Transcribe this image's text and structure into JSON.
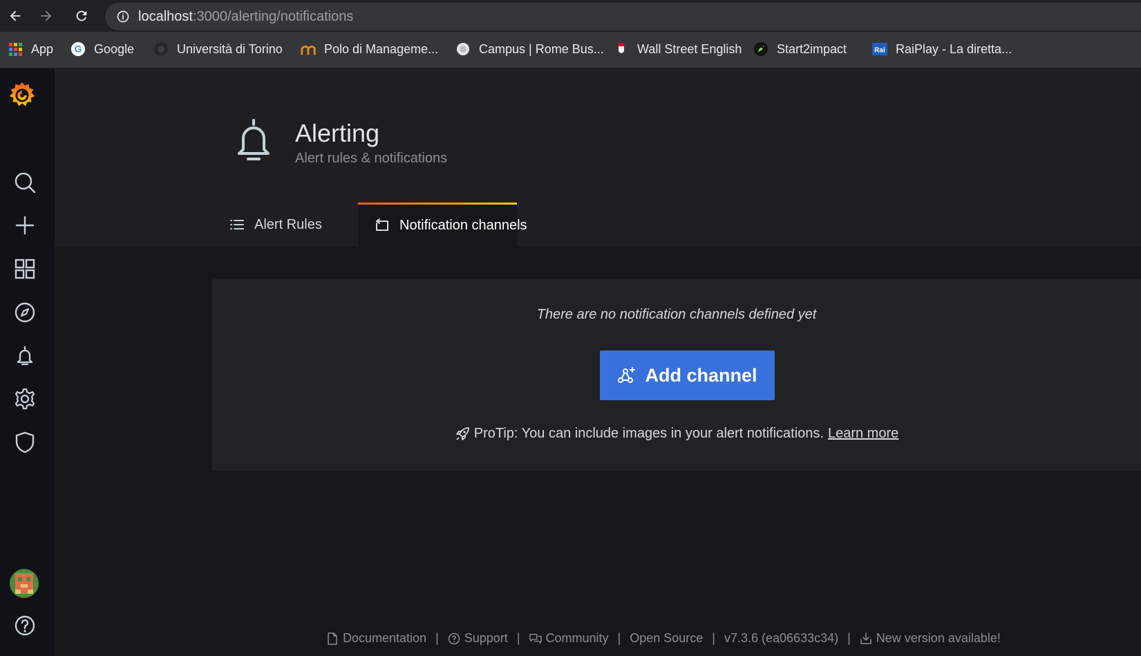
{
  "browser": {
    "url_host": "localhost",
    "url_rest": ":3000/alerting/notifications",
    "bookmarks": [
      {
        "label": "App",
        "icon": "apps-grid-icon"
      },
      {
        "label": "Google",
        "icon": "google-icon"
      },
      {
        "label": "Università di Torino",
        "icon": "unito-icon"
      },
      {
        "label": "Polo di Manageme...",
        "icon": "polo-icon"
      },
      {
        "label": "Campus | Rome Bus...",
        "icon": "campus-icon"
      },
      {
        "label": "Wall Street English",
        "icon": "wse-icon"
      },
      {
        "label": "Start2impact",
        "icon": "rocket-icon"
      },
      {
        "label": "RaiPlay - La diretta...",
        "icon": "rai-icon"
      }
    ]
  },
  "sidebar": {
    "items": [
      {
        "name": "search",
        "icon": "search-icon"
      },
      {
        "name": "create",
        "icon": "plus-icon"
      },
      {
        "name": "dashboards",
        "icon": "apps-icon"
      },
      {
        "name": "explore",
        "icon": "compass-icon"
      },
      {
        "name": "alerting",
        "icon": "bell-icon"
      },
      {
        "name": "configuration",
        "icon": "gear-icon"
      },
      {
        "name": "server-admin",
        "icon": "shield-icon"
      },
      {
        "name": "help",
        "icon": "question-icon"
      }
    ]
  },
  "header": {
    "title": "Alerting",
    "subtitle": "Alert rules & notifications",
    "tabs": [
      {
        "label": "Alert Rules",
        "icon": "list-icon",
        "active": false
      },
      {
        "label": "Notification channels",
        "icon": "comment-alt-share-icon",
        "active": true
      }
    ]
  },
  "empty_state": {
    "message": "There are no notification channels defined yet",
    "button_label": "Add channel",
    "protip": "ProTip: You can include images in your alert notifications.",
    "learn_more": "Learn more"
  },
  "footer": {
    "documentation": "Documentation",
    "support": "Support",
    "community": "Community",
    "open_source": "Open Source",
    "version": "v7.3.6 (ea06633c34)",
    "new_version": "New version available!"
  },
  "colors": {
    "accent_blue": "#3871dc",
    "tab_gradient_start": "#f05a28",
    "tab_gradient_end": "#fbca0a",
    "background": "#161719"
  }
}
